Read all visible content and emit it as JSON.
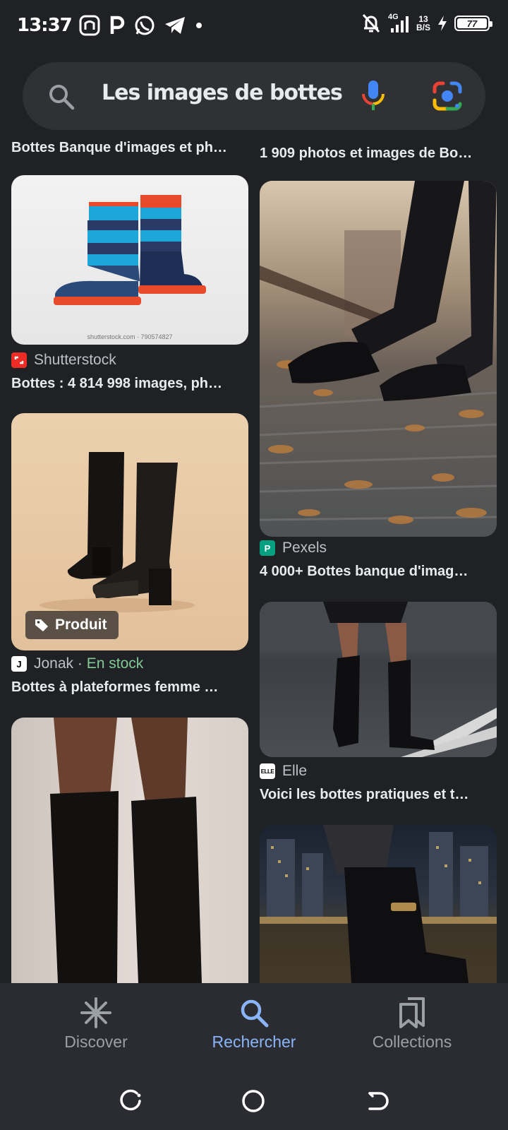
{
  "status_bar": {
    "time": "13:37",
    "net_badge": "4G",
    "net_speed_value": "13",
    "net_speed_unit": "B/S",
    "battery": "77"
  },
  "search": {
    "query": "Les images de bottes"
  },
  "results": {
    "left": [
      {
        "title": "Bottes Banque d'images et ph…"
      },
      {
        "source": "Shutterstock",
        "title": "Bottes : 4 814 998 images, ph…",
        "watermark": "shutterstock.com · 790574827"
      },
      {
        "source": "Jonak",
        "separator": " · ",
        "stock": "En stock",
        "title": "Bottes à plateformes femme …",
        "chip": "Produit"
      },
      {}
    ],
    "right": [
      {
        "title": "1 909 photos et images de Bo…"
      },
      {
        "source": "Pexels",
        "title": "4 000+ Bottes banque d'imag…"
      },
      {
        "source": "Elle",
        "title": "Voici les bottes pratiques et t…"
      },
      {}
    ]
  },
  "bottom_nav": {
    "discover": "Discover",
    "search": "Rechercher",
    "collections": "Collections"
  },
  "colors": {
    "background": "#1f2125",
    "active": "#8ab4f8",
    "in_stock": "#81c995"
  }
}
